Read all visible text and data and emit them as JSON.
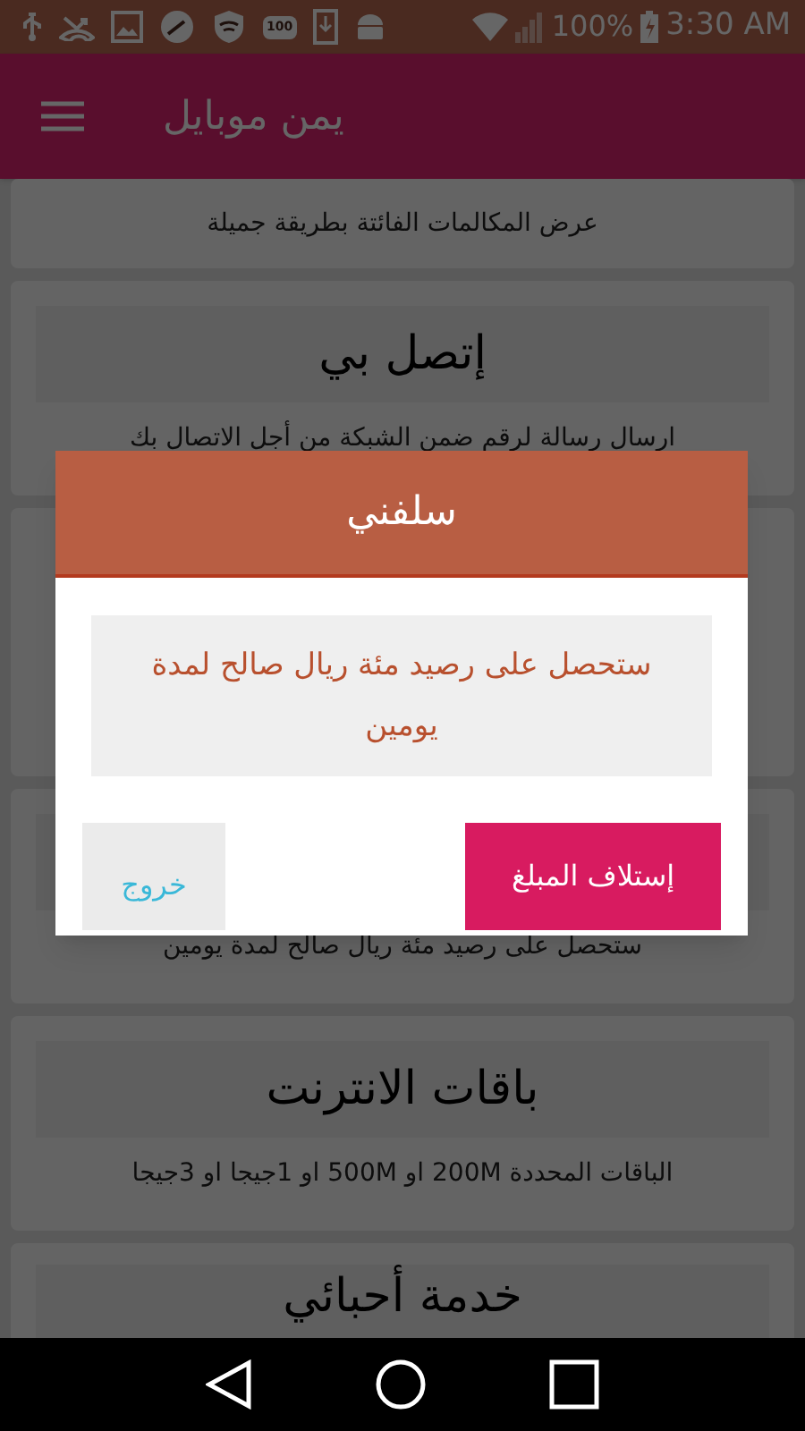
{
  "status_bar": {
    "badge": "100",
    "battery": "100%",
    "time": "3:30 AM"
  },
  "app_bar": {
    "title": "يمن موبايل"
  },
  "cards": [
    {
      "description": "عرض المكالمات الفائتة بطريقة جميلة",
      "kind": "partial"
    },
    {
      "title": "إتصل بي",
      "description": "ارسال رسالة لرقم ضمن الشبكة من أجل الاتصال بك",
      "kind": "full"
    },
    {
      "kind": "hidden"
    },
    {
      "description": "ستحصل على رصيد مئة ريال صالح لمدة يومين",
      "kind": "full"
    },
    {
      "title": "باقات الانترنت",
      "description": "الباقات المحددة 200M او 500M او 1جيجا او 3جيجا",
      "kind": "full"
    },
    {
      "title": "خدمة أحبائي",
      "kind": "cut"
    }
  ],
  "dialog": {
    "title": "سلفني",
    "message": "ستحصل على رصيد مئة ريال صالح لمدة يومين",
    "confirm": "إستلاف المبلغ",
    "exit": "خروج"
  }
}
